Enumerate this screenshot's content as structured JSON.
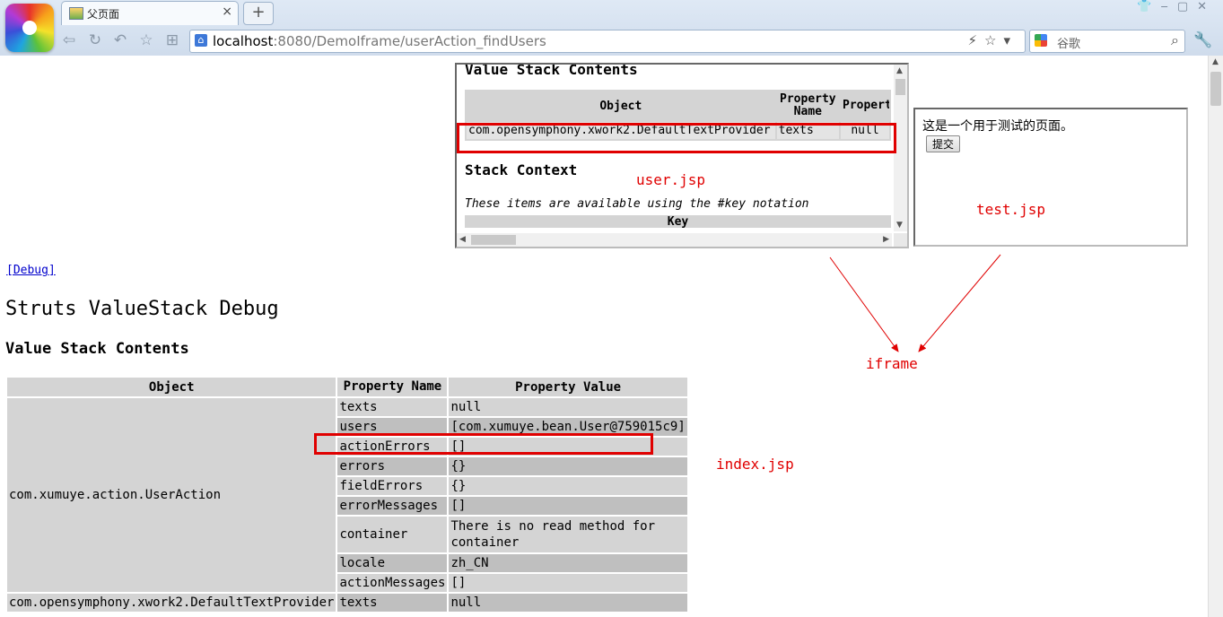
{
  "browser": {
    "tab_title": "父页面",
    "tab_close": "×",
    "new_tab": "+",
    "window_controls": "👕‒▢✕",
    "url_host": "localhost",
    "url_rest": ":8080/DemoIframe/userAction_findUsers",
    "search_placeholder": "谷歌",
    "address_tools": "⚡☆▾"
  },
  "iframe_user": {
    "heading": "Value Stack Contents",
    "table": {
      "headers": [
        "Object",
        "Property Name",
        "Property Value"
      ],
      "rows": [
        {
          "object": "com.opensymphony.xwork2.DefaultTextProvider",
          "name": "texts",
          "value": "null"
        }
      ]
    },
    "context_heading": "Stack Context",
    "note": "These items are available using the #key notation",
    "key_header": "Key"
  },
  "iframe_test": {
    "text": "这是一个用于测试的页面。",
    "submit_label": "提交"
  },
  "main": {
    "debug_link": "[Debug]",
    "title": "Struts ValueStack Debug",
    "subtitle": "Value Stack Contents",
    "headers": [
      "Object",
      "Property Name",
      "Property Value"
    ],
    "object1": "com.xumuye.action.UserAction",
    "object2": "com.opensymphony.xwork2.DefaultTextProvider",
    "rows": [
      {
        "name": "texts",
        "value": "null"
      },
      {
        "name": "users",
        "value": "[com.xumuye.bean.User@759015c9]"
      },
      {
        "name": "actionErrors",
        "value": "[]"
      },
      {
        "name": "errors",
        "value": "{}"
      },
      {
        "name": "fieldErrors",
        "value": "{}"
      },
      {
        "name": "errorMessages",
        "value": "[]"
      },
      {
        "name": "container",
        "value": "There is no read method for container"
      },
      {
        "name": "locale",
        "value": "zh_CN"
      },
      {
        "name": "actionMessages",
        "value": "[]"
      }
    ],
    "row2": {
      "name": "texts",
      "value": "null"
    }
  },
  "annotations": {
    "user_jsp": "user.jsp",
    "test_jsp": "test.jsp",
    "iframe": "iframe",
    "index_jsp": "index.jsp",
    "color": "#e00000"
  }
}
